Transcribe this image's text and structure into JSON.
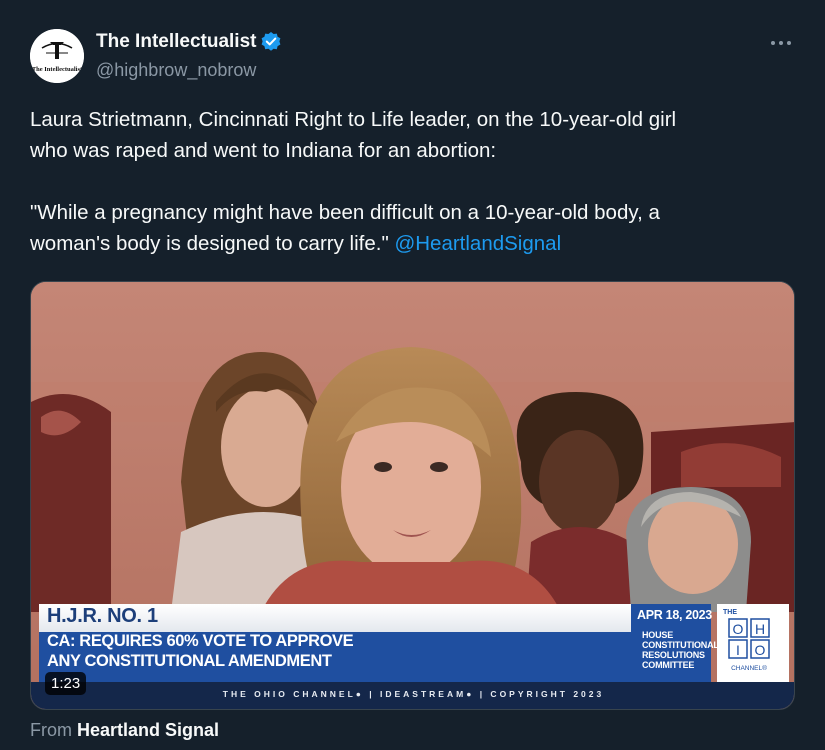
{
  "author": {
    "display_name": "The Intellectualist",
    "handle": "@highbrow_nobrow",
    "verified": true,
    "avatar_text": "The Intellectualist"
  },
  "tweet": {
    "line1": "Laura Strietmann, Cincinnati Right to Life leader, on the 10-year-old girl",
    "line2": "who was raped and went to Indiana for an abortion:",
    "line3": "\"While a pregnancy might have been difficult on a 10-year-old body, a",
    "line4": "woman's body is designed to carry life.\"",
    "mention": "@HeartlandSignal"
  },
  "more_icon": "more-horizontal-icon",
  "video": {
    "duration": "1:23",
    "lower_third": {
      "bill": "H.J.R. NO. 1",
      "headline_line1": "CA: REQUIRES 60% VOTE TO APPROVE",
      "headline_line2": "ANY CONSTITUTIONAL AMENDMENT",
      "date": "APR 18, 2023",
      "committee_line1": "HOUSE",
      "committee_line2": "CONSTITUTIONAL",
      "committee_line3": "RESOLUTIONS",
      "committee_line4": "COMMITTEE",
      "logo_the": "THE",
      "logo_channel": "CHANNEL®",
      "credit": "THE OHIO CHANNEL● | IDEASTREAM● | COPYRIGHT 2023"
    }
  },
  "source": {
    "prefix": "From",
    "name": "Heartland Signal"
  },
  "colors": {
    "background": "#15202b",
    "text": "#f7f9f9",
    "secondary": "#8b98a5",
    "link": "#1d9bf0",
    "banner_blue": "#1f4fa0"
  }
}
